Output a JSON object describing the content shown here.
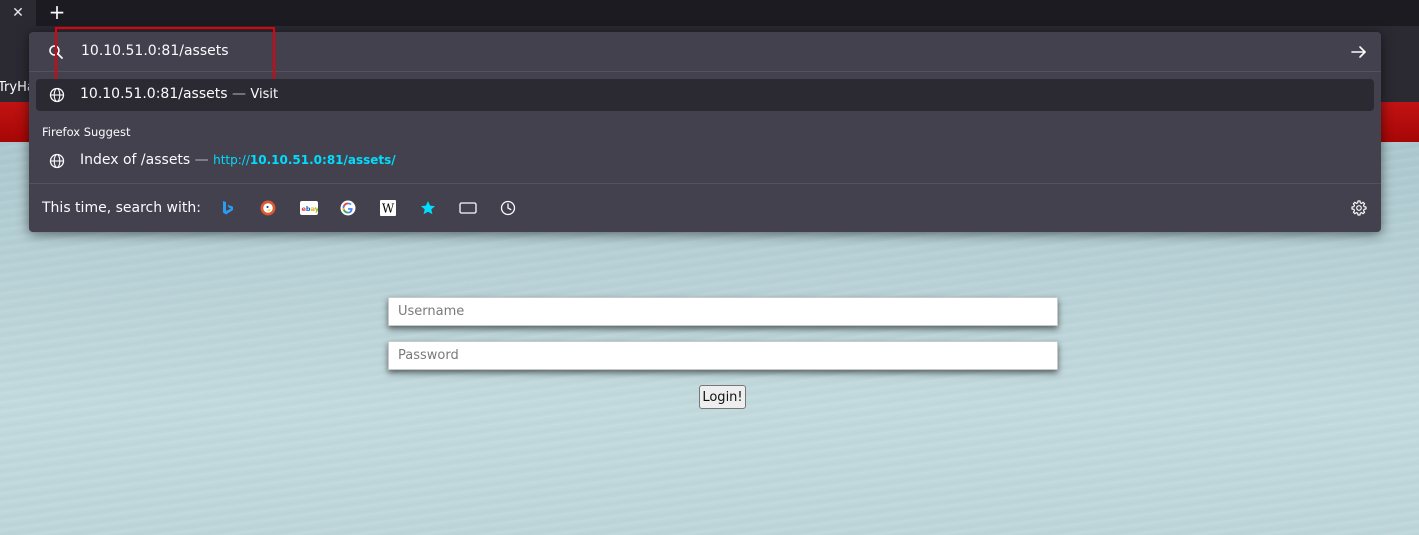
{
  "tabstrip": {
    "close_glyph": "✕",
    "new_tab_glyph": "+"
  },
  "bookmarks": {
    "partial_label": "TryHa"
  },
  "urlbar": {
    "value": "10.10.51.0:81/assets",
    "highlight_color": "#e1000b"
  },
  "results": {
    "visit": {
      "title": "10.10.51.0:81/assets",
      "separator": "—",
      "action": "Visit"
    },
    "suggest_heading": "Firefox Suggest",
    "suggest": {
      "title": "Index of /assets",
      "separator": "—",
      "url_prefix": "http://",
      "url_bold": "10.10.51.0:81/assets/",
      "url_color": "#00ddff"
    }
  },
  "search_with": {
    "label": "This time, search with:",
    "engines": [
      "bing-icon",
      "duckduckgo-icon",
      "ebay-icon",
      "google-icon",
      "wikipedia-icon",
      "bookmarks-star-icon",
      "tabs-icon",
      "history-clock-icon"
    ]
  },
  "page": {
    "banner_color": "#a70606",
    "username_placeholder": "Username",
    "password_placeholder": "Password",
    "login_label": "Login!"
  }
}
